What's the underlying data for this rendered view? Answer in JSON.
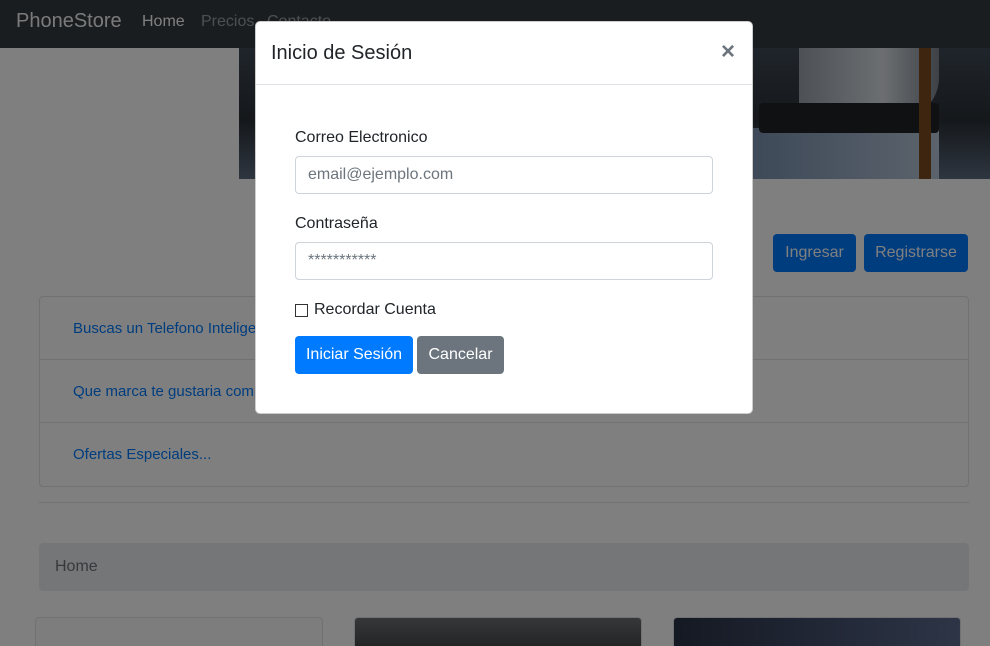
{
  "navbar": {
    "brand": "PhoneStore",
    "links": [
      "Home",
      "Precios",
      "Contacto"
    ]
  },
  "page": {
    "buttons": {
      "ingresar": "Ingresar",
      "registrarse": "Registrarse"
    },
    "list_items": [
      "Buscas un Telefono Inteligente?",
      "Que marca te gustaria comprar?",
      "Ofertas Especiales..."
    ],
    "breadcrumb": "Home"
  },
  "modal": {
    "title": "Inicio de Sesión",
    "close": "×",
    "email_label": "Correo Electronico",
    "email_placeholder": "email@ejemplo.com",
    "password_label": "Contraseña",
    "password_placeholder": "***********",
    "remember_label": "Recordar Cuenta",
    "remember_checked": false,
    "login_button": "Iniciar Sesión",
    "cancel_button": "Cancelar"
  },
  "colors": {
    "primary": "#007bff",
    "secondary": "#6c757d",
    "navbar": "#343a40"
  }
}
